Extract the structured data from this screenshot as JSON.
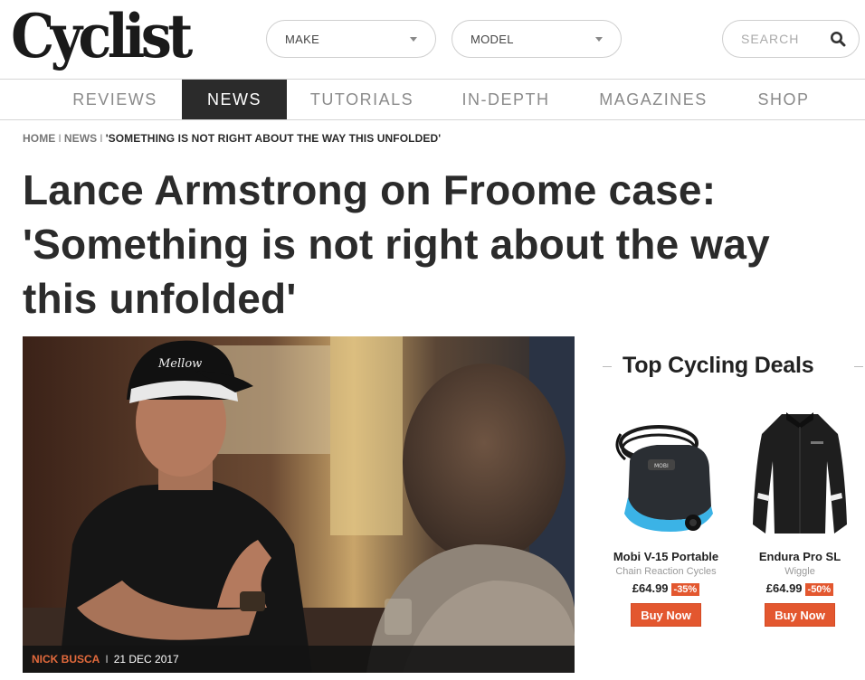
{
  "logo": {
    "text": "Cyclist"
  },
  "filters": {
    "make_label": "MAKE",
    "model_label": "MODEL"
  },
  "search": {
    "placeholder": "SEARCH",
    "icon": "search-icon"
  },
  "nav": {
    "items": [
      {
        "label": "REVIEWS"
      },
      {
        "label": "NEWS",
        "active": true
      },
      {
        "label": "TUTORIALS"
      },
      {
        "label": "IN-DEPTH"
      },
      {
        "label": "MAGAZINES"
      },
      {
        "label": "SHOP"
      }
    ]
  },
  "breadcrumb": {
    "home": "HOME",
    "news": "NEWS",
    "current": "'SOMETHING IS NOT RIGHT ABOUT THE WAY THIS UNFOLDED'",
    "separator": "I"
  },
  "article": {
    "headline": "Lance Armstrong on Froome case: 'Something is not right about the way this unfolded'",
    "author": "NICK BUSCA",
    "date": "21 DEC 2017",
    "caption_separator": "I",
    "cap_text": "Mellow"
  },
  "deals": {
    "title": "Top Cycling Deals",
    "items": [
      {
        "name": "Mobi V-15 Portable",
        "store": "Chain Reaction Cycles",
        "price": "£64.99",
        "discount": "-35%",
        "button": "Buy Now",
        "product_text": "MOBI"
      },
      {
        "name": "Endura Pro SL",
        "store": "Wiggle",
        "price": "£64.99",
        "discount": "-50%",
        "button": "Buy Now"
      }
    ]
  },
  "colors": {
    "accent": "#e3572f",
    "nav_active_bg": "#2b2b2b",
    "text_dark": "#2b2b2b"
  }
}
